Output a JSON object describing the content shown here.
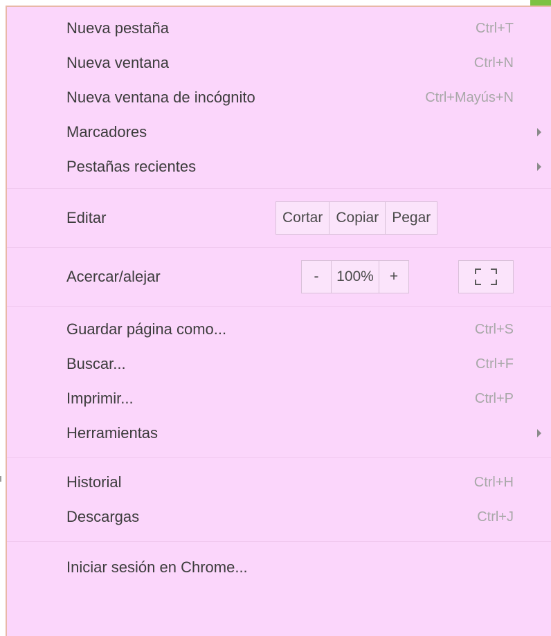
{
  "menu": {
    "section1": [
      {
        "label": "Nueva pestaña",
        "shortcut": "Ctrl+T"
      },
      {
        "label": "Nueva ventana",
        "shortcut": "Ctrl+N"
      },
      {
        "label": "Nueva ventana de incógnito",
        "shortcut": "Ctrl+Mayús+N"
      },
      {
        "label": "Marcadores",
        "submenu": true
      },
      {
        "label": "Pestañas recientes",
        "submenu": true
      }
    ],
    "edit": {
      "label": "Editar",
      "cut": "Cortar",
      "copy": "Copiar",
      "paste": "Pegar"
    },
    "zoom": {
      "label": "Acercar/alejar",
      "minus": "-",
      "value": "100%",
      "plus": "+"
    },
    "section2": [
      {
        "label": "Guardar página como...",
        "shortcut": "Ctrl+S"
      },
      {
        "label": "Buscar...",
        "shortcut": "Ctrl+F"
      },
      {
        "label": "Imprimir...",
        "shortcut": "Ctrl+P"
      },
      {
        "label": "Herramientas",
        "submenu": true
      }
    ],
    "section3": [
      {
        "label": "Historial",
        "shortcut": "Ctrl+H"
      },
      {
        "label": "Descargas",
        "shortcut": "Ctrl+J"
      }
    ],
    "section4": [
      {
        "label": "Iniciar sesión en Chrome..."
      }
    ]
  },
  "colors": {
    "menu_background": "#fbd6fb",
    "shortcut_text": "#a8a8a8",
    "corner_accent": "#7cc242"
  }
}
